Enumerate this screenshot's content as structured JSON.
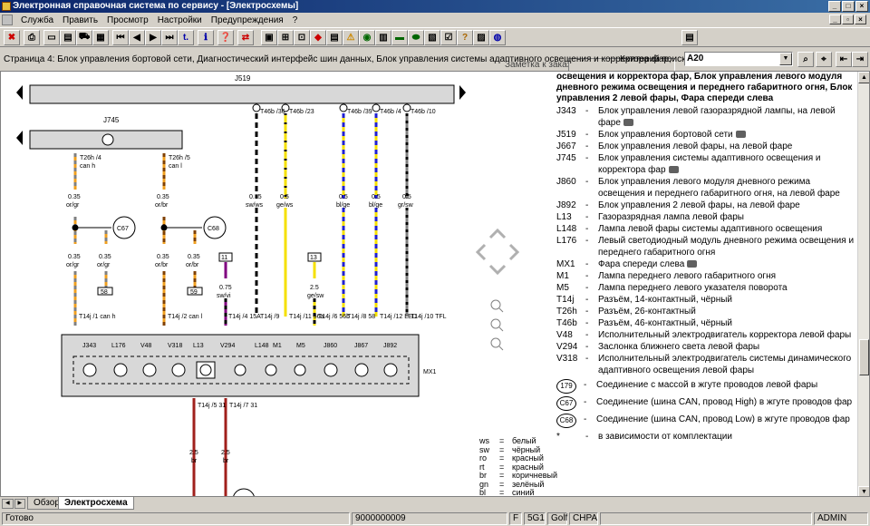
{
  "window": {
    "title": "Электронная справочная система по сервису - [Электросхемы]"
  },
  "menu": [
    "Служба",
    "Править",
    "Просмотр",
    "Настройки",
    "Предупреждения",
    "?"
  ],
  "toolbar": {
    "order_label": "Заметка к заказу:",
    "order_value": ""
  },
  "path": {
    "text": "Страница 4: Блок управления бортовой сети, Диагностический интерфейс шин данных, Блок управления системы адаптивного освещения и корректора фар,",
    "criteria_label": "Критерий поиска:",
    "criteria_value": "A20"
  },
  "diagram": {
    "top_label": "J519",
    "second_label": "J745",
    "module_label": "MX1",
    "connectors_top": [
      {
        "id": "T46b /36",
        "wire": "0.75",
        "color": "sw/ws"
      },
      {
        "id": "T46b /23",
        "wire": "0.5",
        "color": "ge/ws"
      },
      {
        "id": "T46b /39",
        "wire": "0.5",
        "color": "bl/ge"
      },
      {
        "id": "T46b /4",
        "wire": "0.5",
        "color": "bl/ge"
      },
      {
        "id": "T46b /10",
        "wire": "0.5",
        "color": "gr/sw"
      }
    ],
    "can_left": [
      {
        "id": "T26h /4",
        "sub": "can h",
        "wire": "0.35",
        "color": "or/gr"
      },
      {
        "id": "T26h /5",
        "sub": "can l",
        "wire": "0.35",
        "color": "or/br"
      }
    ],
    "circles": [
      "C67",
      "C68"
    ],
    "splice_left": [
      {
        "wire": "0.35",
        "color": "or/gr"
      },
      {
        "wire": "0.35",
        "color": "or/gr"
      },
      {
        "wire": "0.35",
        "color": "or/br"
      },
      {
        "wire": "0.35",
        "color": "or/br"
      }
    ],
    "boxes": [
      "58",
      "59",
      "11",
      "13"
    ],
    "mid_wires": [
      {
        "wire": "0.75",
        "color": "sw/vi"
      },
      {
        "wire": "2.5",
        "color": "ge/sw"
      }
    ],
    "bottom_connectors": [
      "T14j /1 can h",
      "T14j /2 can l",
      "T14j /4 15A",
      "T14j /9",
      "T14j /11 56a",
      "T14j /6 56b",
      "T14j /8 58",
      "T14j /12 LED",
      "T14j /10 TFL"
    ],
    "components": [
      "J343",
      "L176",
      "V48",
      "V318",
      "L13",
      "V294",
      "L148",
      "M1",
      "M5",
      "J860",
      "J867",
      "J892"
    ],
    "lower": [
      {
        "id": "T14j /5 31",
        "wire": "2.5",
        "color": "br"
      },
      {
        "id": "T14j /7 31",
        "wire": "2.5",
        "color": "br"
      }
    ]
  },
  "legend": {
    "heading": "освещения и корректора фар, Блок управления левого модуля дневного режима освещения и переднего габаритного огня, Блок управления 2 левой фары, Фара спереди слева",
    "rows": [
      {
        "code": "J343",
        "desc": "Блок управления левой газоразрядной лампы, на левой фаре",
        "cam": true
      },
      {
        "code": "J519",
        "desc": "Блок управления бортовой сети",
        "cam": true
      },
      {
        "code": "J667",
        "desc": "Блок управления левой фары, на левой фаре",
        "cam": false
      },
      {
        "code": "J745",
        "desc": "Блок управления системы адаптивного освещения и корректора фар",
        "cam": true
      },
      {
        "code": "J860",
        "desc": "Блок управления левого модуля дневного режима освещения и переднего габаритного огня, на левой фаре",
        "cam": false
      },
      {
        "code": "J892",
        "desc": "Блок управления 2 левой фары, на левой фаре",
        "cam": false
      },
      {
        "code": "L13",
        "desc": "Газоразрядная лампа левой фары",
        "cam": false
      },
      {
        "code": "L148",
        "desc": "Лампа левой фары системы адаптивного освещения",
        "cam": false
      },
      {
        "code": "L176",
        "desc": "Левый светодиодный модуль дневного режима освещения и переднего габаритного огня",
        "cam": false
      },
      {
        "code": "MX1",
        "desc": "Фара спереди слева",
        "cam": true
      },
      {
        "code": "M1",
        "desc": "Лампа переднего левого габаритного огня",
        "cam": false
      },
      {
        "code": "M5",
        "desc": "Лампа переднего левого указателя поворота",
        "cam": false
      },
      {
        "code": "T14j",
        "desc": "Разъём, 14-контактный, чёрный",
        "cam": false
      },
      {
        "code": "T26h",
        "desc": "Разъём, 26-контактный",
        "cam": false
      },
      {
        "code": "T46b",
        "desc": "Разъём, 46-контактный, чёрный",
        "cam": false
      },
      {
        "code": "V48",
        "desc": "Исполнительный электродвигатель корректора левой фары",
        "cam": false
      },
      {
        "code": "V294",
        "desc": "Заслонка ближнего света левой фары",
        "cam": false
      },
      {
        "code": "V318",
        "desc": "Исполнительный электродвигатель системы динамического адаптивного освещения левой фары",
        "cam": false
      }
    ],
    "circle_rows": [
      {
        "code": "179",
        "desc": "Соединение с массой в жгуте проводов левой фары"
      },
      {
        "code": "C67",
        "desc": "Соединение (шина CAN, провод High) в жгуте проводов фар"
      },
      {
        "code": "C68",
        "desc": "Соединение (шина CAN, провод Low) в жгуте проводов фар"
      }
    ],
    "footnote": {
      "code": "*",
      "desc": "в зависимости от комплектации"
    }
  },
  "colors": [
    {
      "c": "ws",
      "n": "белый"
    },
    {
      "c": "sw",
      "n": "чёрный"
    },
    {
      "c": "ro",
      "n": "красный"
    },
    {
      "c": "rt",
      "n": "красный"
    },
    {
      "c": "br",
      "n": "коричневый"
    },
    {
      "c": "gn",
      "n": "зелёный"
    },
    {
      "c": "bl",
      "n": "синий"
    }
  ],
  "tabs": [
    "Обзор",
    "Электросхема"
  ],
  "status": {
    "ready": "Готово",
    "num": "9000000009",
    "f": "F",
    "code": "5G1",
    "model": "Golf",
    "engine": "CHPA",
    "user": "ADMIN"
  },
  "accent": {
    "title_bar": "#0a246a",
    "wire_orange": "#f0a020",
    "wire_yellow": "#f5e000",
    "wire_blue": "#2020d0"
  }
}
